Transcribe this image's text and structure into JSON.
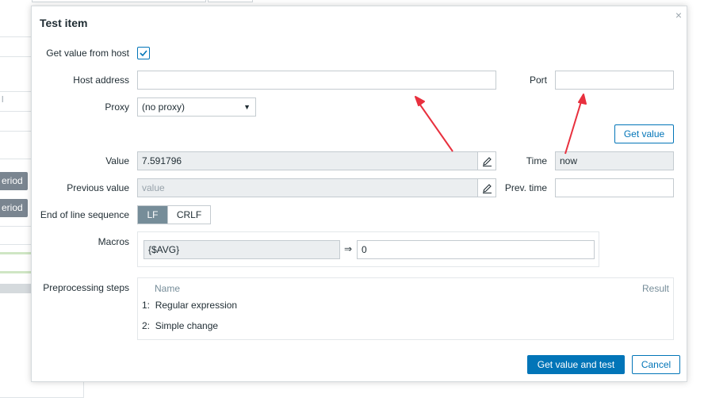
{
  "background": {
    "buttons": [
      "eriod",
      "eriod"
    ],
    "stub_text": "l"
  },
  "dialog": {
    "title": "Test item",
    "close_glyph": "×"
  },
  "form": {
    "get_value_from_host_label": "Get value from host",
    "get_value_from_host_checked": true,
    "host_address_label": "Host address",
    "host_address_value": "",
    "port_label": "Port",
    "port_value": "",
    "proxy_label": "Proxy",
    "proxy_selected": "(no proxy)",
    "get_value_button": "Get value",
    "value_label": "Value",
    "value_value": "7.591796",
    "time_label": "Time",
    "time_value": "now",
    "previous_value_label": "Previous value",
    "previous_value_placeholder": "value",
    "prev_time_label": "Prev. time",
    "prev_time_value": "",
    "eol_label": "End of line sequence",
    "eol_options": [
      "LF",
      "CRLF"
    ],
    "eol_selected": "LF",
    "macros_label": "Macros",
    "macro_name": "{$AVG}",
    "macro_arrow": "⇒",
    "macro_value": "0",
    "preprocessing_label": "Preprocessing steps",
    "steps_header_name": "Name",
    "steps_header_result": "Result",
    "steps": [
      {
        "num": "1:",
        "name": "Regular expression"
      },
      {
        "num": "2:",
        "name": "Simple change"
      }
    ]
  },
  "footer": {
    "test_button": "Get value and test",
    "cancel_button": "Cancel"
  },
  "icons": {
    "edit": "pencil-icon",
    "annotation": "red-arrow",
    "annotation_color": "#e8303e",
    "accent": "#0275b8"
  }
}
